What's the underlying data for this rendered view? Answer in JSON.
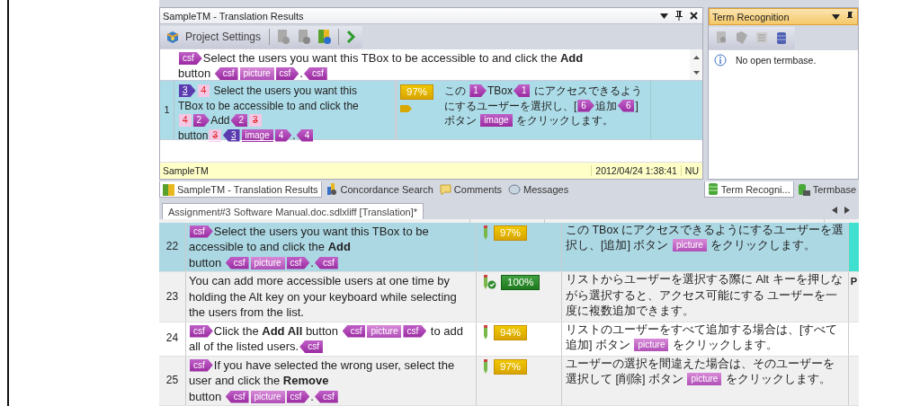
{
  "results_panel": {
    "title": "SampleTM - Translation Results",
    "project_settings": "Project Settings",
    "source": [
      {
        "kind": "open",
        "label": "csf"
      },
      {
        "kind": "text",
        "text": "Select the users you want this TBox to be accessible to and click the **Add**"
      },
      {
        "kind": "break"
      },
      {
        "kind": "text",
        "text": "button "
      },
      {
        "kind": "close",
        "label": "csf"
      },
      {
        "kind": "box_light",
        "label": "picture"
      },
      {
        "kind": "open",
        "label": "csf"
      },
      {
        "kind": "text",
        "text": "."
      },
      {
        "kind": "close",
        "label": "csf"
      }
    ],
    "matches": [
      {
        "number": "1",
        "selected": true,
        "match": {
          "kind": "fuzzy",
          "percent": "97%"
        },
        "source": [
          {
            "kind": "ref_open",
            "label": "3"
          },
          {
            "kind": "deleted_open",
            "label": "4"
          },
          {
            "kind": "text",
            "text": " Select the users you want this TBox to be accessible to and click the"
          },
          {
            "kind": "deleted_close",
            "label": "4"
          },
          {
            "kind": "open",
            "label": "2"
          },
          {
            "kind": "text",
            "text": "Add"
          },
          {
            "kind": "close",
            "label": "2"
          },
          {
            "kind": "deleted_box",
            "label": "3"
          },
          {
            "kind": "break"
          },
          {
            "kind": "text",
            "text": "button"
          },
          {
            "kind": "deleted_box",
            "label": "3"
          },
          {
            "kind": "ref_close",
            "label": "3"
          },
          {
            "kind": "box",
            "label": "image"
          },
          {
            "kind": "open",
            "label": "4"
          },
          {
            "kind": "text",
            "text": "."
          },
          {
            "kind": "close",
            "label": "4"
          }
        ],
        "target": [
          {
            "kind": "text",
            "text": "この "
          },
          {
            "kind": "open",
            "label": "1"
          },
          {
            "kind": "text",
            "text": "TBox"
          },
          {
            "kind": "close",
            "label": "1"
          },
          {
            "kind": "text",
            "text": " にアクセスできるようにするユーザーを選択し、["
          },
          {
            "kind": "open",
            "label": "6"
          },
          {
            "kind": "text",
            "text": "追加"
          },
          {
            "kind": "close",
            "label": "6"
          },
          {
            "kind": "text",
            "text": "] ボタン "
          },
          {
            "kind": "box",
            "label": "image"
          },
          {
            "kind": "text",
            "text": " をクリックします。"
          }
        ]
      }
    ],
    "status": {
      "tm": "SampleTM",
      "date": "2012/04/24 1:38:41",
      "user": "NU"
    }
  },
  "term_panel": {
    "title": "Term Recognition",
    "message": "No open termbase."
  },
  "bottom_tabs": [
    {
      "label": "SampleTM - Translation Results",
      "kind": "tm",
      "selected": true
    },
    {
      "label": "Concordance Search",
      "kind": "concordance",
      "selected": false
    },
    {
      "label": "Comments",
      "kind": "comments",
      "selected": false
    },
    {
      "label": "Messages",
      "kind": "messages",
      "selected": false
    }
  ],
  "side_tabs": [
    {
      "label": "Term Recogni...",
      "kind": "term",
      "selected": true
    },
    {
      "label": "Termbase",
      "kind": "termbase",
      "selected": false
    }
  ],
  "editor": {
    "document_tab": "Assignment#3 Software Manual.doc.sdlxliff [Translation]*",
    "rows": [
      {
        "number": "22",
        "selected": true,
        "match": {
          "kind": "fuzzy",
          "percent": "97%"
        },
        "source": [
          {
            "kind": "open",
            "label": "csf"
          },
          {
            "kind": "text",
            "text": "Select the users you want this TBox to be accessible to and click the **Add**"
          },
          {
            "kind": "break"
          },
          {
            "kind": "text",
            "text": " button "
          },
          {
            "kind": "close",
            "label": "csf"
          },
          {
            "kind": "box_light",
            "label": "picture"
          },
          {
            "kind": "open",
            "label": "csf"
          },
          {
            "kind": "text",
            "text": "."
          },
          {
            "kind": "close",
            "label": "csf"
          }
        ],
        "target": [
          {
            "kind": "text",
            "text": "この TBox にアクセスできるようにするユーザーを選択し、[追加] ボタン "
          },
          {
            "kind": "box_light",
            "label": "picture"
          },
          {
            "kind": "text",
            "text": " をクリックします。"
          }
        ]
      },
      {
        "number": "23",
        "selected": false,
        "match": {
          "kind": "exact",
          "percent": "100%"
        },
        "source": [
          {
            "kind": "text",
            "text": "You can add more accessible users at one time by holding the Alt key on your keyboard while selecting the users from the list."
          }
        ],
        "target": [
          {
            "kind": "text",
            "text": "リストからユーザーを選択する際に Alt キーを押しながら選択すると、アクセス可能にする ユーザーを一度に複数追加できます。"
          }
        ],
        "column_5": "P"
      },
      {
        "number": "24",
        "selected": false,
        "match": {
          "kind": "fuzzy",
          "percent": "94%"
        },
        "source": [
          {
            "kind": "open",
            "label": "csf"
          },
          {
            "kind": "text",
            "text": "Click the **Add All** button "
          },
          {
            "kind": "close",
            "label": "csf"
          },
          {
            "kind": "box_light",
            "label": "picture"
          },
          {
            "kind": "open",
            "label": "csf"
          },
          {
            "kind": "text",
            "text": " to add all of the listed users."
          },
          {
            "kind": "close",
            "label": "csf"
          }
        ],
        "target": [
          {
            "kind": "text",
            "text": "リストのユーザーをすべて追加する場合は、[すべて追加] ボタン "
          },
          {
            "kind": "box_light",
            "label": "picture"
          },
          {
            "kind": "text",
            "text": " をクリックします。"
          }
        ]
      },
      {
        "number": "25",
        "selected": false,
        "match": {
          "kind": "fuzzy",
          "percent": "97%"
        },
        "source": [
          {
            "kind": "open",
            "label": "csf"
          },
          {
            "kind": "text",
            "text": "If you have selected the wrong user, select the user and click the **Remove**"
          },
          {
            "kind": "break"
          },
          {
            "kind": "text",
            "text": " button "
          },
          {
            "kind": "close",
            "label": "csf"
          },
          {
            "kind": "box_light",
            "label": "picture"
          },
          {
            "kind": "open",
            "label": "csf"
          },
          {
            "kind": "text",
            "text": "."
          },
          {
            "kind": "close",
            "label": "csf"
          }
        ],
        "target": [
          {
            "kind": "text",
            "text": "ユーザーの選択を間違えた場合は、そのユーザーを選択して [削除] ボタン "
          },
          {
            "kind": "box_light",
            "label": "picture"
          },
          {
            "kind": "text",
            "text": " をクリックします。"
          }
        ]
      }
    ]
  }
}
